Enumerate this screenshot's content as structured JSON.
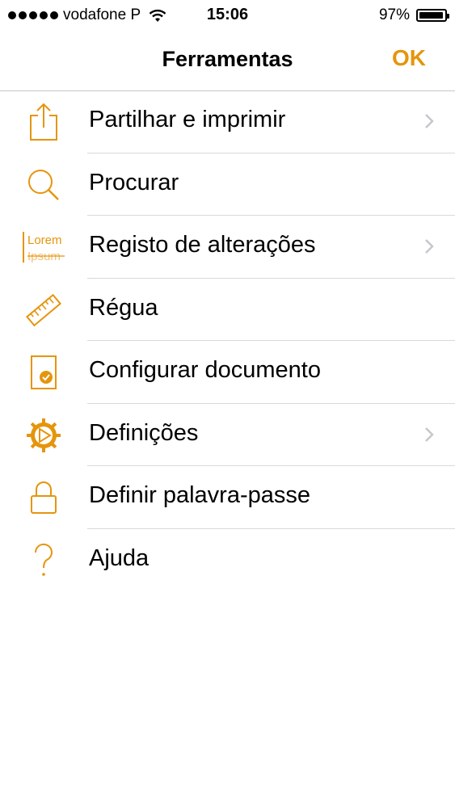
{
  "status_bar": {
    "carrier": "vodafone P",
    "time": "15:06",
    "battery_percent": "97%"
  },
  "nav": {
    "title": "Ferramentas",
    "ok_label": "OK"
  },
  "colors": {
    "accent": "#e5950c",
    "separator": "#d9d9dd",
    "chevron": "#c7c7cc"
  },
  "menu": {
    "items": [
      {
        "label": "Partilhar e imprimir",
        "icon": "share-icon",
        "has_chevron": true
      },
      {
        "label": "Procurar",
        "icon": "search-icon",
        "has_chevron": false
      },
      {
        "label": "Registo de alterações",
        "icon": "track-changes-icon",
        "icon_text_top": "Lorem",
        "icon_text_bottom": "Ipsum",
        "has_chevron": true
      },
      {
        "label": "Régua",
        "icon": "ruler-icon",
        "has_chevron": false
      },
      {
        "label": "Configurar documento",
        "icon": "document-setup-icon",
        "has_chevron": false
      },
      {
        "label": "Definições",
        "icon": "settings-gear-icon",
        "has_chevron": true
      },
      {
        "label": "Definir palavra-passe",
        "icon": "lock-icon",
        "has_chevron": false
      },
      {
        "label": "Ajuda",
        "icon": "help-icon",
        "has_chevron": false
      }
    ]
  }
}
